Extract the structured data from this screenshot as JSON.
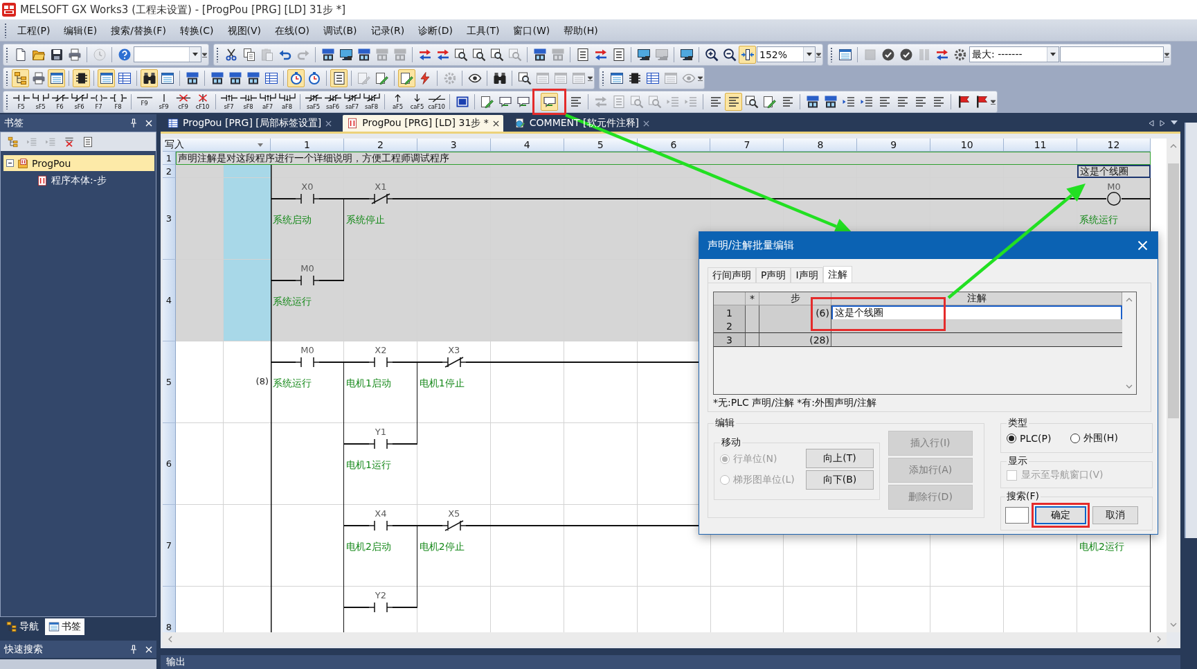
{
  "window": {
    "title": "MELSOFT GX Works3 (工程未设置) - [ProgPou [PRG] [LD] 31步 *]"
  },
  "menu": [
    "工程(P)",
    "编辑(E)",
    "搜索/替换(F)",
    "转换(C)",
    "视图(V)",
    "在线(O)",
    "调试(B)",
    "记录(R)",
    "诊断(D)",
    "工具(T)",
    "窗口(W)",
    "帮助(H)"
  ],
  "toolbars": [
    {
      "strips": [
        {
          "groups": [
            [
              {
                "kind": "new",
                "checked": false,
                "disabled": false
              },
              {
                "kind": "open",
                "checked": false,
                "disabled": false
              },
              {
                "kind": "save",
                "checked": false,
                "disabled": false
              },
              {
                "kind": "print",
                "checked": false,
                "disabled": false
              }
            ],
            [
              {
                "kind": "history",
                "checked": false,
                "disabled": true
              }
            ],
            [
              {
                "kind": "help",
                "checked": false,
                "disabled": false
              },
              {
                "kind": "combo",
                "disabled": false
              }
            ]
          ]
        },
        {
          "groups": [
            [
              {
                "kind": "cut",
                "checked": false,
                "disabled": false
              },
              {
                "kind": "copy",
                "checked": false,
                "disabled": false
              },
              {
                "kind": "paste",
                "checked": false,
                "disabled": true
              },
              {
                "kind": "undo",
                "checked": false,
                "disabled": false
              },
              {
                "kind": "redo",
                "checked": false,
                "disabled": true
              }
            ],
            [
              {
                "kind": "device",
                "checked": false,
                "disabled": false
              },
              {
                "kind": "monitor",
                "checked": false,
                "disabled": false
              },
              {
                "kind": "device",
                "checked": false,
                "disabled": false
              },
              {
                "kind": "device",
                "checked": false,
                "disabled": true
              },
              {
                "kind": "device",
                "checked": false,
                "disabled": true
              }
            ],
            [
              {
                "kind": "transfer",
                "checked": false,
                "disabled": false
              },
              {
                "kind": "transfer",
                "checked": false,
                "disabled": false
              },
              {
                "kind": "search",
                "checked": false,
                "disabled": false
              },
              {
                "kind": "search",
                "checked": false,
                "disabled": false
              },
              {
                "kind": "search",
                "checked": false,
                "disabled": false
              },
              {
                "kind": "search",
                "checked": false,
                "disabled": true
              }
            ],
            [
              {
                "kind": "device",
                "checked": false,
                "disabled": false
              },
              {
                "kind": "device",
                "checked": false,
                "disabled": true
              }
            ],
            [
              {
                "kind": "list",
                "checked": false,
                "disabled": false
              },
              {
                "kind": "transfer",
                "checked": false,
                "disabled": false
              },
              {
                "kind": "list",
                "checked": false,
                "disabled": false
              }
            ],
            [
              {
                "kind": "monitor",
                "checked": false,
                "disabled": false
              },
              {
                "kind": "monitor",
                "checked": false,
                "disabled": true
              }
            ],
            [
              {
                "kind": "monitor",
                "checked": false,
                "disabled": false
              }
            ],
            [
              {
                "kind": "zoom_in",
                "checked": false,
                "disabled": false
              },
              {
                "kind": "zoom_out",
                "checked": false,
                "disabled": false
              },
              {
                "kind": "fit",
                "checked": true,
                "disabled": false
              },
              {
                "kind": "zoom_combo",
                "value": "152%",
                "disabled": false
              }
            ]
          ]
        },
        {
          "groups": [
            [
              {
                "kind": "window",
                "checked": false,
                "disabled": false
              }
            ],
            [
              {
                "kind": "stop",
                "checked": false,
                "disabled": true
              },
              {
                "kind": "check",
                "checked": false,
                "disabled": false
              },
              {
                "kind": "check",
                "checked": false,
                "disabled": false
              },
              {
                "kind": "bars",
                "checked": false,
                "disabled": true
              },
              {
                "kind": "transfer",
                "checked": false,
                "disabled": false
              },
              {
                "kind": "gear",
                "checked": false,
                "disabled": false
              },
              {
                "kind": "monitor_combo",
                "value": "最大: -------",
                "disabled": false
              },
              {
                "kind": "field",
                "disabled": false
              }
            ]
          ]
        }
      ]
    },
    {
      "strips": [
        {
          "groups": [
            [
              {
                "kind": "tree",
                "checked": true,
                "disabled": false
              },
              {
                "kind": "print",
                "checked": false,
                "disabled": false
              },
              {
                "kind": "window",
                "checked": true,
                "disabled": false
              }
            ],
            [
              {
                "kind": "chip",
                "checked": true,
                "disabled": false
              }
            ],
            [
              {
                "kind": "window",
                "checked": true,
                "disabled": false
              },
              {
                "kind": "table",
                "checked": false,
                "disabled": false
              }
            ],
            [
              {
                "kind": "binoculars",
                "checked": true,
                "disabled": false
              },
              {
                "kind": "window",
                "checked": false,
                "disabled": false
              }
            ],
            [
              {
                "kind": "device",
                "checked": false,
                "disabled": false
              }
            ],
            [
              {
                "kind": "device",
                "checked": false,
                "disabled": false
              },
              {
                "kind": "device",
                "checked": false,
                "disabled": false
              },
              {
                "kind": "device",
                "checked": false,
                "disabled": false
              },
              {
                "kind": "table",
                "checked": false,
                "disabled": false
              }
            ],
            [
              {
                "kind": "watch",
                "checked": true,
                "disabled": false
              },
              {
                "kind": "watch",
                "checked": false,
                "disabled": false
              }
            ],
            [
              {
                "kind": "list",
                "checked": true,
                "disabled": false
              }
            ],
            [
              {
                "kind": "edit",
                "checked": false,
                "disabled": true
              },
              {
                "kind": "edit",
                "checked": false,
                "disabled": false
              }
            ],
            [
              {
                "kind": "edit",
                "checked": true,
                "disabled": false
              },
              {
                "kind": "lightning",
                "checked": false,
                "disabled": false
              }
            ],
            [
              {
                "kind": "gear",
                "checked": false,
                "disabled": true
              }
            ],
            [
              {
                "kind": "eye",
                "checked": false,
                "disabled": false
              }
            ],
            [
              {
                "kind": "binoculars",
                "checked": false,
                "disabled": false
              }
            ],
            [
              {
                "kind": "search",
                "checked": false,
                "disabled": false
              },
              {
                "kind": "window",
                "checked": false,
                "disabled": true
              },
              {
                "kind": "window",
                "checked": false,
                "disabled": true
              },
              {
                "kind": "window",
                "checked": false,
                "disabled": true
              }
            ]
          ]
        },
        {
          "groups": [
            [
              {
                "kind": "window",
                "checked": false,
                "disabled": false
              },
              {
                "kind": "chip",
                "checked": false,
                "disabled": false
              },
              {
                "kind": "table",
                "checked": false,
                "disabled": false
              },
              {
                "kind": "window",
                "checked": false,
                "disabled": true
              },
              {
                "kind": "eye",
                "checked": false,
                "disabled": true
              }
            ]
          ]
        }
      ]
    },
    {
      "strips": [
        {
          "groups": [
            [
              {
                "kind": "contact",
                "key": "F5",
                "checked": false,
                "disabled": false
              },
              {
                "kind": "contact_branch",
                "key": "sF5",
                "checked": false,
                "disabled": false
              },
              {
                "kind": "contact_nc",
                "key": "F6",
                "checked": false,
                "disabled": false
              },
              {
                "kind": "contact_nc_branch",
                "key": "sF6",
                "checked": false,
                "disabled": false
              },
              {
                "kind": "coil",
                "key": "F7",
                "checked": false,
                "disabled": false
              },
              {
                "kind": "instruction",
                "key": "F8",
                "checked": false,
                "disabled": false
              }
            ],
            [
              {
                "kind": "hline",
                "key": "F9",
                "checked": false,
                "disabled": false
              },
              {
                "kind": "vline",
                "key": "sF9",
                "checked": false,
                "disabled": false
              },
              {
                "kind": "hline_delete",
                "key": "cF9",
                "checked": false,
                "disabled": false
              },
              {
                "kind": "vline_delete",
                "key": "cF10",
                "checked": false,
                "disabled": false
              }
            ],
            [
              {
                "kind": "rise",
                "key": "sF7",
                "checked": false,
                "disabled": false
              },
              {
                "kind": "fall",
                "key": "sF8",
                "checked": false,
                "disabled": false
              },
              {
                "kind": "rise_branch",
                "key": "aF7",
                "checked": false,
                "disabled": false
              },
              {
                "kind": "fall_branch",
                "key": "aF8",
                "checked": false,
                "disabled": false
              }
            ],
            [
              {
                "kind": "rise_nc",
                "key": "saF5",
                "checked": false,
                "disabled": false
              },
              {
                "kind": "fall_nc",
                "key": "saF6",
                "checked": false,
                "disabled": false
              },
              {
                "kind": "rise_nc_branch",
                "key": "saF7",
                "checked": false,
                "disabled": false
              },
              {
                "kind": "fall_nc_branch",
                "key": "saF8",
                "checked": false,
                "disabled": false
              }
            ],
            [
              {
                "kind": "arrow_up",
                "key": "aF5",
                "checked": false,
                "disabled": false
              },
              {
                "kind": "arrow_down",
                "key": "caF5",
                "checked": false,
                "disabled": false
              },
              {
                "kind": "invert",
                "key": "caF10",
                "checked": false,
                "disabled": false
              }
            ],
            [
              {
                "kind": "panel",
                "checked": false,
                "disabled": false
              }
            ],
            [
              {
                "kind": "edit",
                "checked": false,
                "disabled": false
              },
              {
                "kind": "comment",
                "checked": false,
                "disabled": false
              },
              {
                "kind": "comment",
                "checked": false,
                "disabled": false
              },
              {
                "kind": "comment",
                "checked": true,
                "disabled": false
              },
              {
                "kind": "lines",
                "checked": false,
                "disabled": false
              }
            ],
            [
              {
                "kind": "transfer",
                "checked": false,
                "disabled": true
              },
              {
                "kind": "list",
                "checked": false,
                "disabled": true
              },
              {
                "kind": "search",
                "checked": false,
                "disabled": true
              },
              {
                "kind": "search",
                "checked": false,
                "disabled": true
              },
              {
                "kind": "indent",
                "checked": false,
                "disabled": true
              },
              {
                "kind": "indent",
                "checked": false,
                "disabled": true
              }
            ],
            [
              {
                "kind": "lines",
                "checked": false,
                "disabled": false
              },
              {
                "kind": "lines",
                "checked": true,
                "disabled": false
              },
              {
                "kind": "search",
                "checked": false,
                "disabled": false
              },
              {
                "kind": "edit",
                "checked": false,
                "disabled": false
              },
              {
                "kind": "lines",
                "checked": false,
                "disabled": false
              }
            ],
            [
              {
                "kind": "device",
                "checked": false,
                "disabled": false
              },
              {
                "kind": "device",
                "checked": false,
                "disabled": false
              },
              {
                "kind": "indent",
                "checked": false,
                "disabled": false
              },
              {
                "kind": "indent",
                "checked": false,
                "disabled": false
              },
              {
                "kind": "lines",
                "checked": false,
                "disabled": false
              },
              {
                "kind": "lines",
                "checked": false,
                "disabled": false
              },
              {
                "kind": "lines",
                "checked": false,
                "disabled": false
              },
              {
                "kind": "lines",
                "checked": false,
                "disabled": false
              }
            ],
            [
              {
                "kind": "flag",
                "checked": false,
                "disabled": false
              },
              {
                "kind": "flag",
                "checked": false,
                "disabled": false
              }
            ]
          ]
        }
      ]
    }
  ],
  "bookmarks": {
    "title": "书签",
    "tools": [
      {
        "kind": "tree",
        "checked": false,
        "disabled": false
      },
      {
        "kind": "indent",
        "checked": false,
        "disabled": true
      },
      {
        "kind": "indent",
        "checked": false,
        "disabled": true
      },
      {
        "kind": "delete",
        "checked": false,
        "disabled": false
      },
      {
        "kind": "list",
        "checked": false,
        "disabled": false
      }
    ],
    "tree": [
      {
        "label": "ProgPou",
        "selected": true,
        "expanded": true,
        "children": [
          {
            "label": "程序本体:-步",
            "selected": false
          }
        ]
      }
    ],
    "tabs": [
      {
        "label": "导航",
        "kind": "navigation",
        "selected": false
      },
      {
        "label": "书签",
        "kind": "bookmarks",
        "selected": true
      }
    ]
  },
  "quick_search": {
    "title": "快速搜索"
  },
  "editor_tabs": [
    {
      "label": "ProgPou [PRG] [局部标签设置]",
      "kind": "labels",
      "selected": false
    },
    {
      "label": "ProgPou [PRG] [LD] 31步 *",
      "kind": "ladder",
      "selected": true
    },
    {
      "label": "COMMENT [软元件注释]",
      "kind": "comment",
      "selected": false
    }
  ],
  "ladder": {
    "mode": "写入",
    "columns": [
      "1",
      "2",
      "3",
      "4",
      "5",
      "6",
      "7",
      "8",
      "9",
      "10",
      "11",
      "12"
    ],
    "statement": {
      "number": "1",
      "text": "声明注解是对这段程序进行一个详细说明，方便工程师调试程序"
    },
    "rows": [
      {
        "number": "2",
        "kind": "note",
        "selected": true,
        "cells": [
          {
            "kind": "empty"
          },
          {
            "kind": "empty"
          },
          {
            "kind": "empty"
          },
          {
            "kind": "empty"
          },
          {
            "kind": "empty"
          },
          {
            "kind": "empty"
          },
          {
            "kind": "empty"
          },
          {
            "kind": "empty"
          },
          {
            "kind": "empty"
          },
          {
            "kind": "empty"
          },
          {
            "kind": "empty"
          },
          {
            "kind": "note",
            "text": "这是个线圈",
            "selected": true
          }
        ]
      },
      {
        "number": "3",
        "kind": "rung",
        "selected": true,
        "cells": [
          {
            "kind": "contact_no",
            "device": "X0",
            "comment": "系统启动"
          },
          {
            "kind": "contact_nc",
            "device": "X1",
            "comment": "系统停止",
            "link_down": true
          },
          {
            "kind": "wire"
          },
          {
            "kind": "wire"
          },
          {
            "kind": "wire"
          },
          {
            "kind": "wire"
          },
          {
            "kind": "wire"
          },
          {
            "kind": "wire"
          },
          {
            "kind": "wire"
          },
          {
            "kind": "wire"
          },
          {
            "kind": "wire"
          },
          {
            "kind": "coil",
            "device": "M0",
            "comment": "系统运行"
          }
        ]
      },
      {
        "number": "4",
        "kind": "rung",
        "selected": true,
        "cells": [
          {
            "kind": "contact_no",
            "device": "M0",
            "comment": "系统运行"
          },
          {
            "kind": "empty"
          },
          {
            "kind": "empty"
          },
          {
            "kind": "empty"
          },
          {
            "kind": "empty"
          },
          {
            "kind": "empty"
          },
          {
            "kind": "empty"
          },
          {
            "kind": "empty"
          },
          {
            "kind": "empty"
          },
          {
            "kind": "empty"
          },
          {
            "kind": "empty"
          },
          {
            "kind": "empty"
          }
        ]
      },
      {
        "number": "5",
        "kind": "rung",
        "selected": false,
        "step": "(8)",
        "cells": [
          {
            "kind": "contact_no",
            "device": "M0",
            "comment": "系统运行"
          },
          {
            "kind": "contact_no",
            "device": "X2",
            "comment": "电机1启动",
            "link_down": true
          },
          {
            "kind": "contact_nc",
            "device": "X3",
            "comment": "电机1停止",
            "link_down": true
          },
          {
            "kind": "wire"
          },
          {
            "kind": "wire"
          },
          {
            "kind": "wire"
          },
          {
            "kind": "wire"
          },
          {
            "kind": "wire"
          },
          {
            "kind": "wire"
          },
          {
            "kind": "wire"
          },
          {
            "kind": "wire"
          },
          {
            "kind": "wire"
          }
        ]
      },
      {
        "number": "6",
        "kind": "rung",
        "selected": false,
        "cells": [
          {
            "kind": "empty"
          },
          {
            "kind": "contact_no",
            "device": "Y1",
            "comment": "电机1运行",
            "link_down": true
          },
          {
            "kind": "empty"
          },
          {
            "kind": "empty"
          },
          {
            "kind": "empty"
          },
          {
            "kind": "empty"
          },
          {
            "kind": "empty"
          },
          {
            "kind": "empty"
          },
          {
            "kind": "empty"
          },
          {
            "kind": "empty"
          },
          {
            "kind": "empty"
          },
          {
            "kind": "empty"
          }
        ]
      },
      {
        "number": "7",
        "kind": "rung",
        "selected": false,
        "cells": [
          {
            "kind": "empty"
          },
          {
            "kind": "contact_no",
            "device": "X4",
            "comment": "电机2启动",
            "link_down": true
          },
          {
            "kind": "contact_nc",
            "device": "X5",
            "comment": "电机2停止",
            "link_down": true
          },
          {
            "kind": "wire"
          },
          {
            "kind": "wire"
          },
          {
            "kind": "wire"
          },
          {
            "kind": "wire"
          },
          {
            "kind": "wire"
          },
          {
            "kind": "wire"
          },
          {
            "kind": "wire"
          },
          {
            "kind": "wire"
          },
          {
            "kind": "wire",
            "comment": "电机2运行"
          }
        ]
      },
      {
        "number": "8",
        "kind": "rung",
        "selected": false,
        "cells": [
          {
            "kind": "empty"
          },
          {
            "kind": "contact_no",
            "device": "Y2",
            "link_down": true
          },
          {
            "kind": "empty"
          },
          {
            "kind": "empty"
          },
          {
            "kind": "empty"
          },
          {
            "kind": "empty"
          },
          {
            "kind": "empty"
          },
          {
            "kind": "empty"
          },
          {
            "kind": "empty"
          },
          {
            "kind": "empty"
          },
          {
            "kind": "empty"
          },
          {
            "kind": "empty"
          }
        ]
      }
    ]
  },
  "dialog": {
    "title": "声明/注解批量编辑",
    "tabs": [
      {
        "label": "行间声明",
        "selected": false
      },
      {
        "label": "P声明",
        "selected": false
      },
      {
        "label": "I声明",
        "selected": false
      },
      {
        "label": "注解",
        "selected": true
      }
    ],
    "table": {
      "columns": [
        "*",
        "步",
        "注解"
      ],
      "rows": [
        {
          "number": "1",
          "step": "(6)",
          "comment": "这是个线圈",
          "selected": true
        },
        {
          "number": "2",
          "selected": false
        },
        {
          "number": "3",
          "step": "(28)",
          "selected": false
        }
      ]
    },
    "note": "*无:PLC 声明/注解 *有:外围声明/注解",
    "edit": {
      "title": "编辑",
      "move": {
        "title": "移动",
        "options": [
          {
            "label": "行单位(N)",
            "selected": true,
            "disabled": true
          },
          {
            "label": "梯形图单位(L)",
            "selected": false,
            "disabled": true
          }
        ],
        "buttons": [
          {
            "label": "向上(T)",
            "disabled": false
          },
          {
            "label": "向下(B)",
            "disabled": false
          }
        ]
      },
      "buttons": [
        {
          "label": "插入行(I)",
          "disabled": true
        },
        {
          "label": "添加行(A)",
          "disabled": true
        },
        {
          "label": "删除行(D)",
          "disabled": true
        }
      ]
    },
    "type": {
      "title": "类型",
      "options": [
        {
          "label": "PLC(P)",
          "selected": true,
          "disabled": false
        },
        {
          "label": "外围(H)",
          "selected": false,
          "disabled": false
        }
      ]
    },
    "display": {
      "title": "显示",
      "checkbox": {
        "label": "显示至导航窗口(V)",
        "checked": false,
        "disabled": true
      }
    },
    "search": {
      "title": "搜索(F)"
    },
    "buttons": [
      {
        "label": "确定",
        "default": true
      },
      {
        "label": "取消",
        "default": false
      }
    ]
  },
  "output": {
    "title": "输出"
  }
}
